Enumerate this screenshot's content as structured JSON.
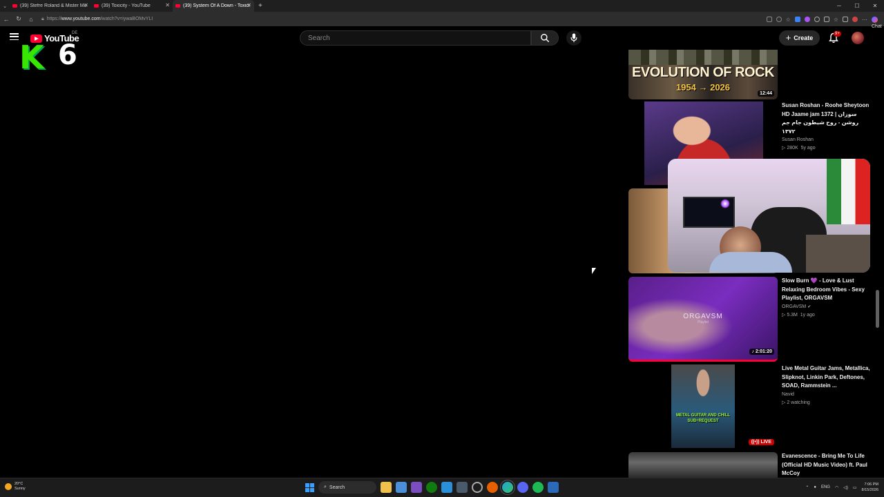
{
  "browser": {
    "tabs": [
      {
        "title": "(39) Stefre Roland & Mister Monj",
        "active": false
      },
      {
        "title": "(39) Toxicity - YouTube",
        "active": false
      },
      {
        "title": "(39) System Of A Down - Toxicity (",
        "active": true
      }
    ],
    "url_prefix": "https://",
    "url_host": "www.youtube.com",
    "url_path": "/watch?v=iywaBOMvYLI",
    "chat_label": "Chat"
  },
  "youtube": {
    "logo_text": "YouTube",
    "country_code": "DE",
    "overlay_letter": "K",
    "overlay_number": "6",
    "search_placeholder": "Search",
    "create_label": "Create",
    "notif_count": "9+"
  },
  "recommendations": [
    {
      "title_lines": [
        "EVOLUTION OF ROCK",
        "1954 → 2026"
      ],
      "duration": "12:44"
    },
    {
      "title": "Susan Roshan - Roohe Sheytoon HD Jaame jam 1372 | سوزان روشن - روح شیطون جام جم ۱۳۷۲",
      "channel": "Susan Roshan",
      "views": "280K",
      "age": "5y ago"
    },
    {
      "title": "Slow Burn 💜 - Love & Lust Relaxing Bedroom Vibes - Sexy Playlist, ORGAVSM",
      "channel": "ORGAVSM",
      "views": "5.3M",
      "age": "1y ago",
      "duration": "2:01:20",
      "thumb_text": "ORGAVSM",
      "thumb_sub": "Playlist"
    },
    {
      "title": "Live Metal Guitar Jams, Metallica, Slipknot, Linkin Park, Deftones, SOAD, Rammstein ...",
      "channel": "Navid",
      "watching": "2 watching",
      "live": "LIVE",
      "thumb_text_1": "METAL GUITAR AND CHILL",
      "thumb_text_2": "SUB=REQUEST"
    },
    {
      "title": "Evanescence - Bring Me To Life (Official HD Music Video) ft. Paul McCoy"
    }
  ],
  "taskbar": {
    "temp": "20°C",
    "weather": "Sunny",
    "search": "Search",
    "lang": "ENG",
    "time": "7:06 PM",
    "date": "8/15/2026"
  },
  "colors": {
    "youtube_red": "#ff0033",
    "overlay_green": "#39e600",
    "live_red": "#cc0000"
  }
}
